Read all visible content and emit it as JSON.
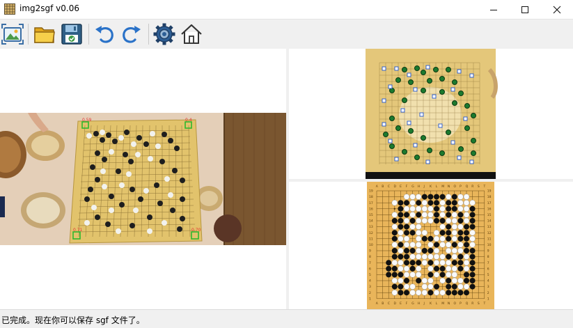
{
  "window": {
    "title": "img2sgf v0.06"
  },
  "toolbar": {
    "buttons": [
      {
        "icon": "image-icon"
      },
      {
        "icon": "open-folder-icon"
      },
      {
        "icon": "save-disk-icon"
      },
      {
        "icon": "undo-icon"
      },
      {
        "icon": "redo-icon"
      },
      {
        "icon": "gear-icon"
      },
      {
        "icon": "home-icon"
      }
    ]
  },
  "photo": {
    "corner_labels": [
      "0.59",
      "0.4",
      "0.71",
      "0.70"
    ]
  },
  "board": {
    "columns": [
      "A",
      "B",
      "C",
      "D",
      "E",
      "F",
      "G",
      "H",
      "J",
      "K",
      "L",
      "M",
      "N",
      "O",
      "P",
      "Q",
      "R",
      "S",
      "T"
    ],
    "rows": [
      "19",
      "18",
      "17",
      "16",
      "15",
      "14",
      "13",
      "12",
      "11",
      "10",
      "9",
      "8",
      "7",
      "6",
      "5",
      "4",
      "3",
      "2",
      "1"
    ]
  },
  "status": {
    "text": "已完成。现在你可以保存 sgf 文件了。"
  },
  "colors": {
    "board_wood": "#e9b55a",
    "photo_board": "#e2c36c",
    "green_detect": "#2db82d"
  }
}
